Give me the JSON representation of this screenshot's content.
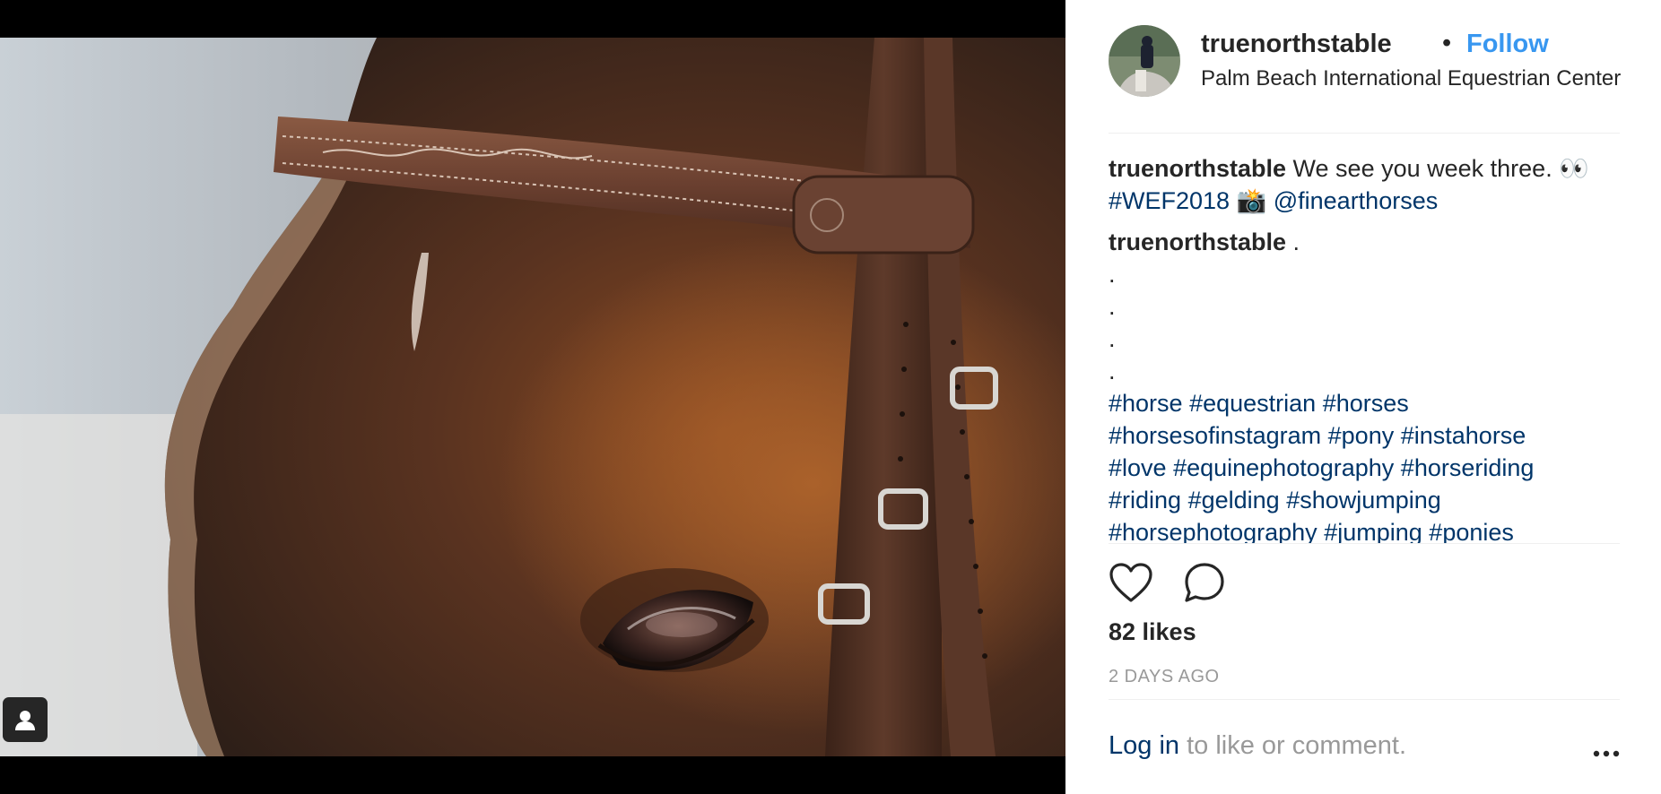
{
  "post": {
    "username": "truenorthstable",
    "separator": "•",
    "follow_label": "Follow",
    "location": "Palm Beach International Equestrian Center",
    "comments": [
      {
        "username": "truenorthstable",
        "text_before": "We see you week three. 👀",
        "hashtag": "#WEF2018",
        "emoji": "📸",
        "mention": "@finearthorses"
      },
      {
        "username": "truenorthstable",
        "text": ".",
        "dots": [
          ".",
          ".",
          ".",
          "."
        ],
        "hashtags": [
          "#horse",
          "#equestrian",
          "#horses",
          "#horsesofinstagram",
          "#pony",
          "#instahorse",
          "#love",
          "#equinephotography",
          "#horseriding",
          "#riding",
          "#gelding",
          "#showjumping",
          "#horsephotography",
          "#jumping",
          "#ponies"
        ]
      }
    ],
    "likes": "82 likes",
    "timestamp": "2 DAYS AGO",
    "login_link": "Log in",
    "login_rest": " to like or comment."
  },
  "icons": {
    "like": "heart-icon",
    "comment": "comment-bubble-icon",
    "more": "more-options-icon",
    "tagged_user": "user-tag-icon"
  },
  "colors": {
    "follow": "#3897f0",
    "link": "#003569",
    "muted": "#999999",
    "text": "#262626"
  }
}
